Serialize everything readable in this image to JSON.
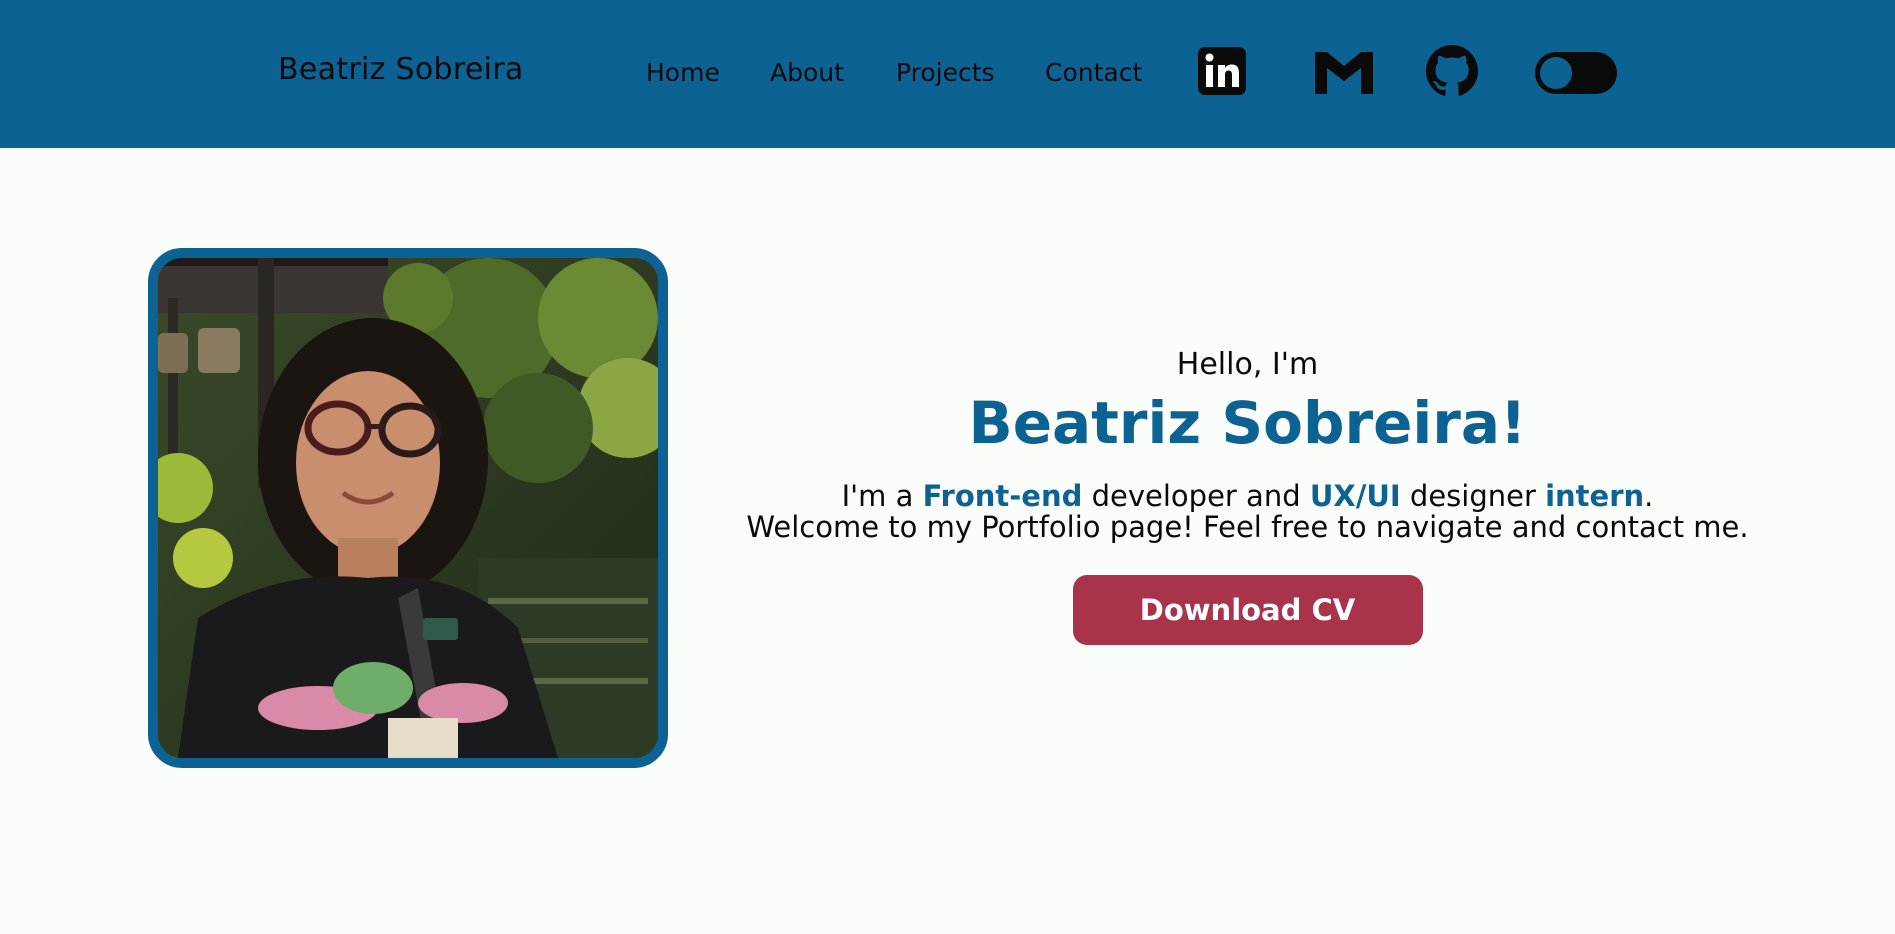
{
  "nav": {
    "brand": "Beatriz Sobreira",
    "links": [
      {
        "label": "Home"
      },
      {
        "label": "About"
      },
      {
        "label": "Projects"
      },
      {
        "label": "Contact"
      }
    ],
    "social_icons": [
      "linkedin-icon",
      "gmail-icon",
      "github-icon"
    ],
    "theme_toggle": "theme-toggle"
  },
  "hero": {
    "greeting": "Hello, I'm",
    "name": "Beatriz Sobreira!",
    "intro_1": "I'm a ",
    "intro_hl_1": "Front-end",
    "intro_2": " developer and ",
    "intro_hl_2": "UX/UI",
    "intro_3": " designer ",
    "intro_hl_3": "intern",
    "intro_4": ".",
    "intro_line_2": "Welcome to my Portfolio page! Feel free to navigate and contact me.",
    "cta_label": "Download CV"
  },
  "colors": {
    "primary": "#0d6294",
    "accent": "#a8334a",
    "background": "#fbfdfa"
  }
}
